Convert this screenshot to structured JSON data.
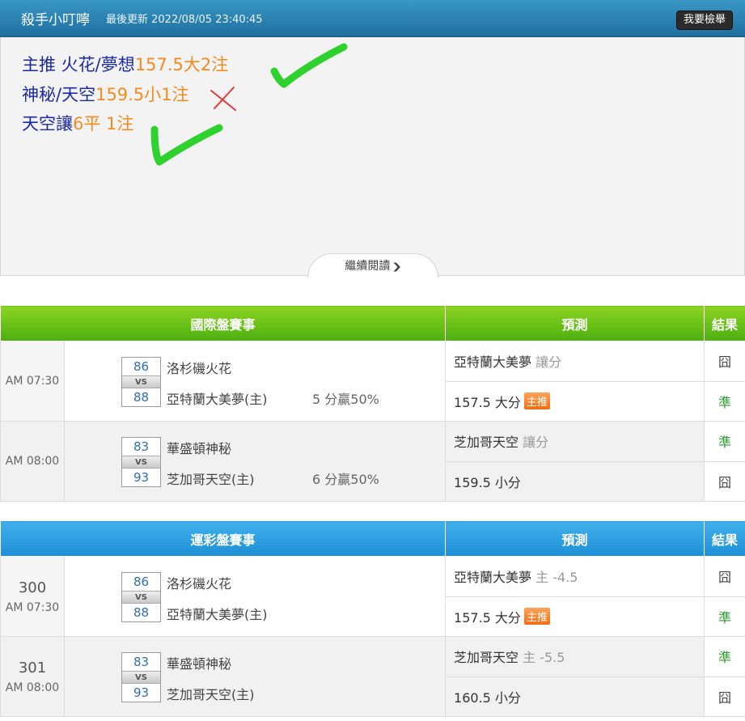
{
  "header": {
    "author": "殺手小叮嚀",
    "updated": "最後更新 2022/08/05 23:40:45",
    "report_label": "我要檢舉"
  },
  "picks": [
    {
      "prefix": "主推 火花/夢想",
      "value": "157.5大2注",
      "mark": "check"
    },
    {
      "prefix": "神秘/天空",
      "value": "159.5小1注",
      "mark": "cross"
    },
    {
      "prefix": "天空讓",
      "value": "6平 1注",
      "mark": "check"
    }
  ],
  "read_more": "繼續閱讀",
  "colors": {
    "blue_text": "#1b2aa6",
    "orange_text": "#f58a1f",
    "check": "#2ed12e",
    "cross": "#e23b3b",
    "win": "#2e9b2e"
  },
  "tables": [
    {
      "title": "國際盤賽事",
      "pred_header": "預測",
      "result_header": "結果",
      "games": [
        {
          "num": "",
          "time": "AM 07:30",
          "score_away": "86",
          "score_home": "88",
          "vs": "VS",
          "away": "洛杉磯火花",
          "home": "亞特蘭大美夢(主)",
          "rate": "5 分贏50%",
          "preds": [
            {
              "team": "亞特蘭大美夢",
              "note": "讓分",
              "tag": "",
              "result": "囧",
              "result_type": "lose"
            },
            {
              "team": "157.5 大分",
              "note": "",
              "tag": "主推",
              "result": "準",
              "result_type": "win"
            }
          ]
        },
        {
          "num": "",
          "time": "AM 08:00",
          "score_away": "83",
          "score_home": "93",
          "vs": "VS",
          "away": "華盛頓神秘",
          "home": "芝加哥天空(主)",
          "rate": "6 分贏50%",
          "preds": [
            {
              "team": "芝加哥天空",
              "note": "讓分",
              "tag": "",
              "result": "準",
              "result_type": "win"
            },
            {
              "team": "159.5 小分",
              "note": "",
              "tag": "",
              "result": "囧",
              "result_type": "lose"
            }
          ]
        }
      ]
    },
    {
      "title": "運彩盤賽事",
      "pred_header": "預測",
      "result_header": "結果",
      "games": [
        {
          "num": "300",
          "time": "AM 07:30",
          "score_away": "86",
          "score_home": "88",
          "vs": "VS",
          "away": "洛杉磯火花",
          "home": "亞特蘭大美夢(主)",
          "rate": "",
          "preds": [
            {
              "team": "亞特蘭大美夢",
              "note": "主 -4.5",
              "tag": "",
              "result": "囧",
              "result_type": "lose"
            },
            {
              "team": "157.5 大分",
              "note": "",
              "tag": "主推",
              "result": "準",
              "result_type": "win"
            }
          ]
        },
        {
          "num": "301",
          "time": "AM 08:00",
          "score_away": "83",
          "score_home": "93",
          "vs": "VS",
          "away": "華盛頓神秘",
          "home": "芝加哥天空(主)",
          "rate": "",
          "preds": [
            {
              "team": "芝加哥天空",
              "note": "主 -5.5",
              "tag": "",
              "result": "準",
              "result_type": "win"
            },
            {
              "team": "160.5 小分",
              "note": "",
              "tag": "",
              "result": "囧",
              "result_type": "lose"
            }
          ]
        }
      ]
    }
  ]
}
